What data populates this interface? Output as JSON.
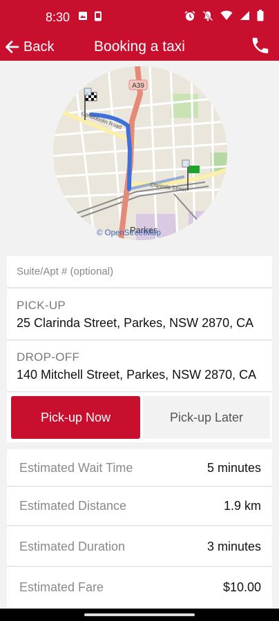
{
  "status_bar": {
    "time": "8:30",
    "icons": [
      "image-icon",
      "phone-device-icon",
      "alarm-icon",
      "mute-icon",
      "wifi-icon",
      "signal-icon",
      "battery-icon"
    ]
  },
  "header": {
    "back_label": "Back",
    "title": "Booking a taxi",
    "call_icon": "phone-icon"
  },
  "map": {
    "road_label": "A39",
    "place_label": "Parkes",
    "street_labels": [
      "Condobolin Road",
      "Clarinda Street"
    ],
    "credit": "© OpenStreetMap"
  },
  "form": {
    "suite_placeholder": "Suite/Apt # (optional)",
    "pickup_label": "PICK-UP",
    "pickup_value": "25 Clarinda Street, Parkes, NSW 2870, CA",
    "dropoff_label": "DROP-OFF",
    "dropoff_value": "140 Mitchell Street, Parkes, NSW 2870, CA"
  },
  "timing": {
    "now_label": "Pick-up Now",
    "later_label": "Pick-up Later",
    "selected": "now"
  },
  "estimates": [
    {
      "label": "Estimated Wait Time",
      "value": "5 minutes"
    },
    {
      "label": "Estimated Distance",
      "value": "1.9 km"
    },
    {
      "label": "Estimated Duration",
      "value": "3 minutes"
    },
    {
      "label": "Estimated Fare",
      "value": "$10.00"
    }
  ],
  "colors": {
    "brand": "#c8102e",
    "route": "#3f6fd8",
    "highway": "#e48a78"
  }
}
